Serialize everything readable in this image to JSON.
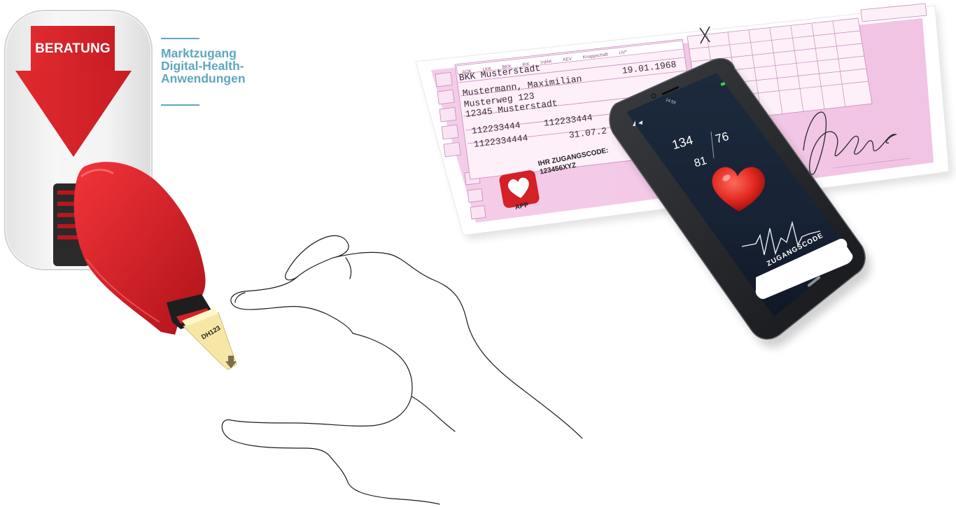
{
  "ticket": {
    "label": "BERATUNG"
  },
  "heading": {
    "lines": [
      "Marktzugang",
      "Digital-Health-",
      "Anwendungen"
    ]
  },
  "prescription": {
    "insurers": [
      "AOK",
      "LKK",
      "BKK",
      "IKK",
      "VdAK",
      "AEV",
      "Knappschaft",
      "UV*"
    ],
    "insurer": "BKK Musterstadt",
    "name": "Mustermann, Maximilian",
    "birthdate": "19.01.1968",
    "street": "Musterweg 123",
    "city": "12345 Musterstadt",
    "insurance_number": "112233444",
    "insured_number": "112233444",
    "office_number": "1122334444",
    "valid_until": "31.07.2",
    "code_caption_line1": "IHR ZUGANGSCODE:",
    "code_caption_line2": "123456XYZ",
    "app_label": "APP"
  },
  "phone": {
    "time": "14:59",
    "systolic": "134",
    "diastolic": "81",
    "pulse": "76",
    "button_label": "ZUGANGSCODE"
  },
  "tape": {
    "code": "DH123"
  },
  "colors": {
    "red": "#d42027",
    "accent": "#5fa7bd",
    "form_pink": "#f2c8e6"
  }
}
